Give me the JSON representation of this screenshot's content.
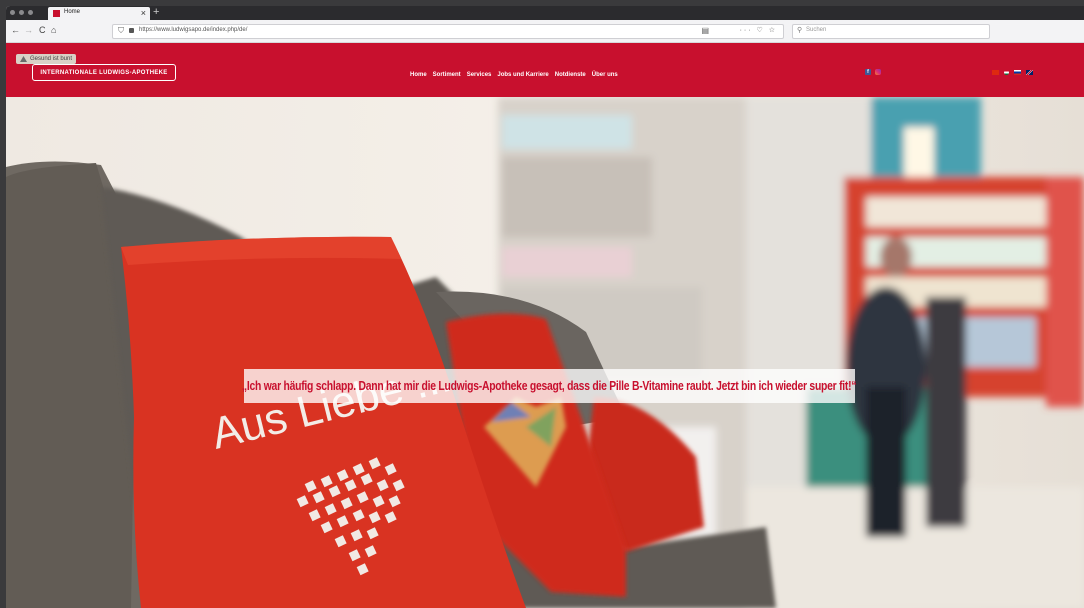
{
  "browser": {
    "tab_title": "Home",
    "tab_close": "×",
    "new_tab": "+",
    "nav_back": "←",
    "nav_forward": "→",
    "nav_reload": "C",
    "nav_home": "⌂",
    "url": "https://www.ludwigsapo.de/index.php/de/",
    "url_actions": "··· ♡ ☆",
    "search_placeholder": "Suchen"
  },
  "site": {
    "badge_text": "Gesund ist bunt",
    "logo_text": "INTERNATIONALE LUDWIGS-APOTHEKE",
    "menu": [
      {
        "label": "Home"
      },
      {
        "label": "Sortiment"
      },
      {
        "label": "Services"
      },
      {
        "label": "Jobs und Karriere"
      },
      {
        "label": "Notdienste"
      },
      {
        "label": "Über uns"
      }
    ],
    "social": {
      "facebook": "f"
    },
    "colors": {
      "brand_red": "#c8102e"
    }
  },
  "hero": {
    "pillow_text": "Aus Liebe ...",
    "quote": "„Ich war häufig schlapp. Dann hat mir die Ludwigs-Apotheke gesagt, dass die Pille B-Vitamine raubt. Jetzt bin ich wieder super fit!“"
  }
}
